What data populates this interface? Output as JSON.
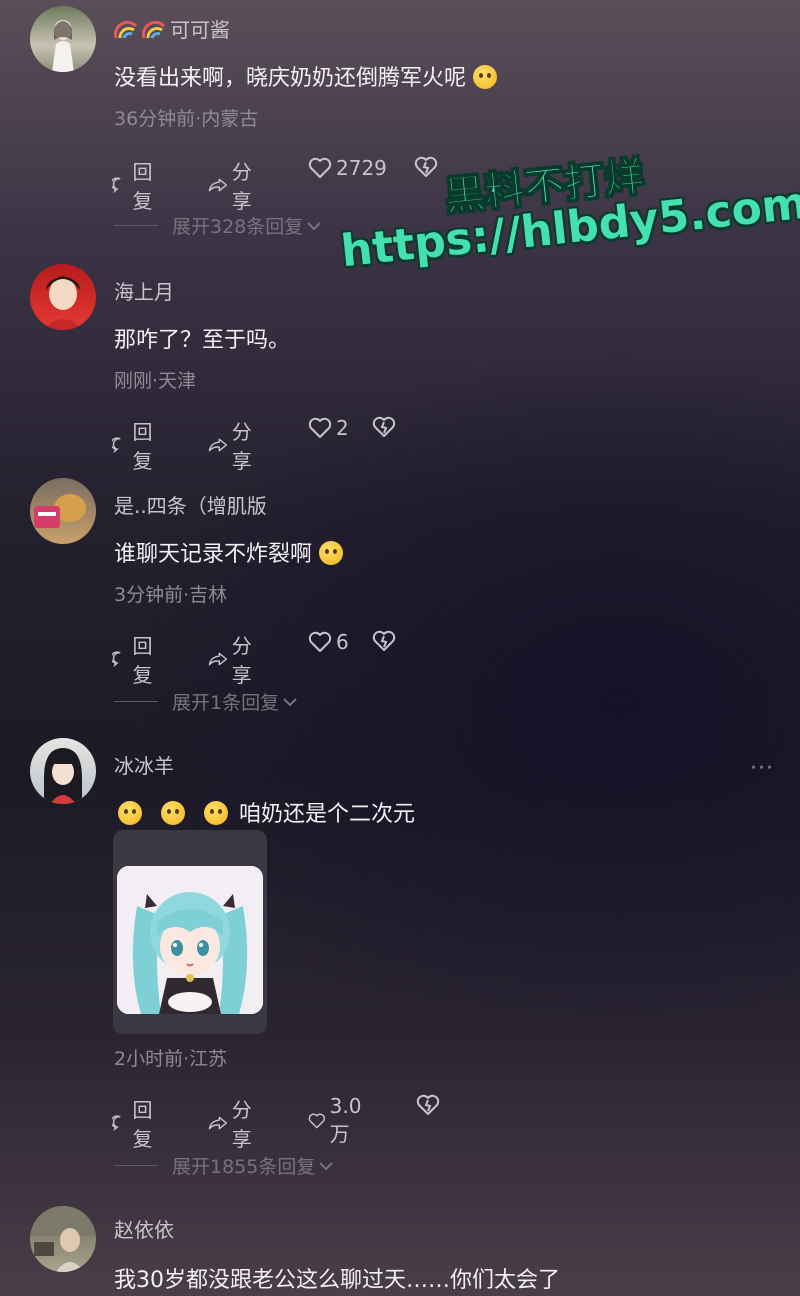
{
  "watermark": {
    "line1": "黑料不打烊",
    "line2": "https://hlbdy5.com"
  },
  "comments": [
    {
      "username": "可可酱",
      "username_prefix_icons": [
        "rainbow-icon",
        "rainbow-icon"
      ],
      "text": "没看出来啊，晓庆奶奶还倒腾军火呢",
      "text_suffix_emoji": "rofl-emoji",
      "meta": "36分钟前·内蒙古",
      "reply_label": "回复",
      "share_label": "分享",
      "likes": "2729",
      "expand": "展开328条回复"
    },
    {
      "username": "海上月",
      "text": "那咋了？至于吗。",
      "meta": "刚刚·天津",
      "reply_label": "回复",
      "share_label": "分享",
      "likes": "2"
    },
    {
      "username": "是..四条（增肌版",
      "text": "谁聊天记录不炸裂啊",
      "text_suffix_emoji": "smirk-emoji",
      "meta": "3分钟前·吉林",
      "reply_label": "回复",
      "share_label": "分享",
      "likes": "6",
      "expand": "展开1条回复"
    },
    {
      "username": "冰冰羊",
      "text": "咱奶还是个二次元",
      "text_prefix_emoji": [
        "grin-emoji",
        "grin-emoji",
        "grin-emoji"
      ],
      "image": "anime-girl-image",
      "meta": "2小时前·江苏",
      "reply_label": "回复",
      "share_label": "分享",
      "likes": "3.0万",
      "expand": "展开1855条回复",
      "more_label": "···"
    },
    {
      "username": "赵依依",
      "text": "我30岁都没跟老公这么聊过天……你们太会了"
    }
  ],
  "colors": {
    "accent_watermark": "#45e0b0",
    "text_primary": "#f3f1f5",
    "text_secondary": "#8f8a96"
  }
}
